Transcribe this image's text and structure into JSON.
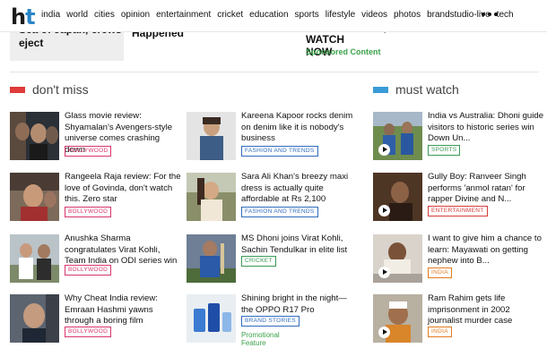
{
  "logo": {
    "h": "h",
    "t": "t"
  },
  "nav": [
    "india",
    "world",
    "cities",
    "opinion",
    "entertainment",
    "cricket",
    "education",
    "sports",
    "lifestyle",
    "videos",
    "photos",
    "brandstudio-live",
    "tech"
  ],
  "previous_row": {
    "card1": "Sea of Japan, crews\neject",
    "card2": "Happened",
    "card3": "on the internet | WATCH\nNOW",
    "card3_sponsored": "Sponsored Content",
    "card4": "..."
  },
  "dont_miss": {
    "title": "don't miss",
    "accent": "#e03a3a",
    "items": [
      {
        "headline": "Glass movie review: Shyamalan's Avengers-style universe comes crashing down",
        "tag": "HOLLYWOOD",
        "tag_color": "pink"
      },
      {
        "headline": "Rangeela Raja review: For the love of Govinda, don't watch this. Zero star",
        "tag": "BOLLYWOOD",
        "tag_color": "pink"
      },
      {
        "headline": "Anushka Sharma congratulates Virat Kohli, Team India on ODI series win",
        "tag": "BOLLYWOOD",
        "tag_color": "pink"
      },
      {
        "headline": "Why Cheat India review: Emraan Hashmi yawns through a boring film",
        "tag": "BOLLYWOOD",
        "tag_color": "pink"
      }
    ]
  },
  "dont_miss_col2": {
    "items": [
      {
        "headline": "Kareena Kapoor rocks denim on denim like it is nobody's business",
        "tag": "FASHION AND TRENDS",
        "tag_color": "blue"
      },
      {
        "headline": "Sara Ali Khan's breezy maxi dress is actually quite affordable at Rs 2,100",
        "tag": "FASHION AND TRENDS",
        "tag_color": "blue"
      },
      {
        "headline": "MS Dhoni joins Virat Kohli, Sachin Tendulkar in elite list",
        "tag": "CRICKET",
        "tag_color": "green"
      },
      {
        "headline": "Shining bright in the night— the OPPO R17 Pro",
        "tag": "BRAND STORIES",
        "tag_color": "blue",
        "promo": "Promotional Feature"
      }
    ]
  },
  "must_watch": {
    "title": "must watch",
    "accent": "#3a9bd9",
    "items": [
      {
        "headline": "India vs Australia: Dhoni guide visitors to historic series win Down Un...",
        "tag": "SPORTS",
        "tag_color": "green"
      },
      {
        "headline": "Gully Boy: Ranveer Singh performs 'anmol ratan' for rapper Divine and N...",
        "tag": "ENTERTAINMENT",
        "tag_color": "red"
      },
      {
        "headline": "I want to give him a chance to learn: Mayawati on getting nephew into B...",
        "tag": "INDIA",
        "tag_color": "orange"
      },
      {
        "headline": "Ram Rahim gets life imprisonment in 2002 journalist murder case",
        "tag": "INDIA",
        "tag_color": "orange"
      }
    ]
  }
}
